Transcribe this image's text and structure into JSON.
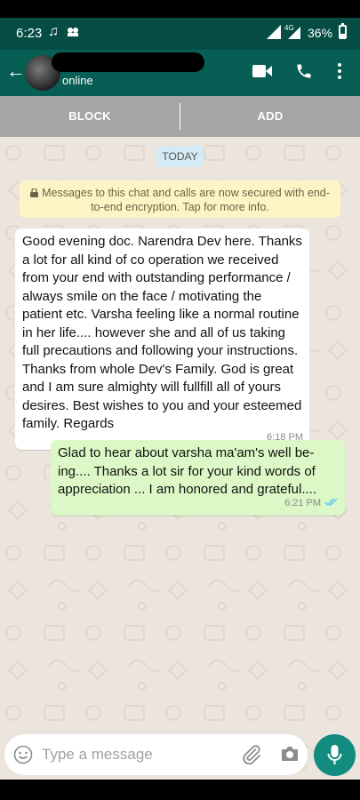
{
  "status_bar": {
    "time": "6:23",
    "network": "4G",
    "battery_percent": "36%",
    "battery_level": 0.36
  },
  "header": {
    "contact_status": "online"
  },
  "actions": {
    "block_label": "BLOCK",
    "add_label": "ADD"
  },
  "chat": {
    "date_chip": "TODAY",
    "encryption_notice": "Messages to this chat and calls are now secured with end-to-end encryption. Tap for more info.",
    "messages": [
      {
        "direction": "incoming",
        "text": "Good evening doc. Narendra Dev here. Thanks a lot for all kind of co operation we received from your end with outstanding performance / always smile on the face / motivating the patient etc. Varsha feeling like a normal routine in her life.... however she and all of us taking full precautions and following your instructions. Thanks from whole Dev's Family. God is great and I am sure almighty will fullfill all of yours desires. Best wishes to you and your esteemed family. Regards",
        "time": "6:18 PM"
      },
      {
        "direction": "outgoing",
        "text": "Glad to hear about varsha ma'am's well be-ing.... Thanks a lot sir for your kind words of appreciation ... I am honored and grateful....",
        "time": "6:21 PM",
        "status": "read"
      }
    ]
  },
  "composer": {
    "placeholder": "Type a message"
  },
  "colors": {
    "header": "#075e54",
    "outgoing_bubble": "#dcf8c6",
    "read_ticks": "#4fc3f7",
    "mic_button": "#128c7e"
  },
  "icons": [
    "back-arrow-icon",
    "video-call-icon",
    "phone-icon",
    "more-vert-icon",
    "lock-icon",
    "double-check-icon",
    "emoji-icon",
    "attach-icon",
    "camera-icon",
    "mic-icon"
  ]
}
